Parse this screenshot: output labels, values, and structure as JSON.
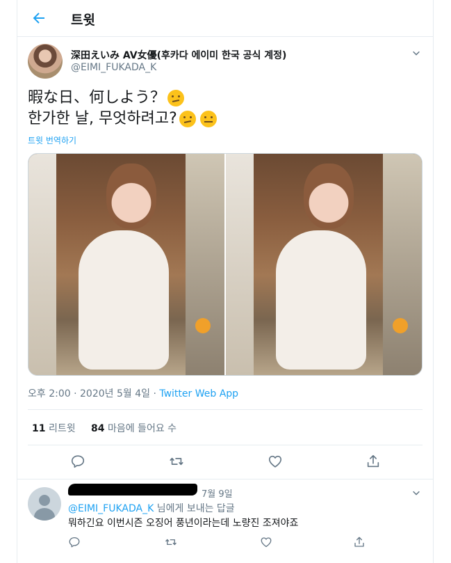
{
  "header": {
    "title": "트윗"
  },
  "tweet": {
    "display_name": "深田えいみ AV女優(후카다 에이미 한국 공식 계정)",
    "handle": "@EIMI_FUKADA_K",
    "text_line1": "暇な日、何しよう？",
    "text_line2": "한가한 날, 무엇하려고?",
    "translate_label": "트윗 번역하기",
    "time": "오후 2:00",
    "date": "2020년 5월 4일",
    "separator": "·",
    "source_app": "Twitter Web App",
    "retweet_count": "11",
    "retweet_label": "리트윗",
    "like_count": "84",
    "like_label": "마음에 들어요 수"
  },
  "reply": {
    "date": "7월 9일",
    "replying_to_mention": "@EIMI_FUKADA_K",
    "replying_to_suffix": " 님에게 보내는 답글",
    "text": "뭐하긴요 이번시즌 오징어 풍년이라는데 노량진 조져야죠"
  },
  "icons": {
    "back": "arrow-left-icon",
    "more": "chevron-down-icon",
    "reply": "reply-icon",
    "retweet": "retweet-icon",
    "like": "heart-icon",
    "share": "share-icon"
  },
  "colors": {
    "accent": "#1da1f2",
    "text_primary": "#14171a",
    "text_secondary": "#657786",
    "border": "#e6ecf0"
  }
}
